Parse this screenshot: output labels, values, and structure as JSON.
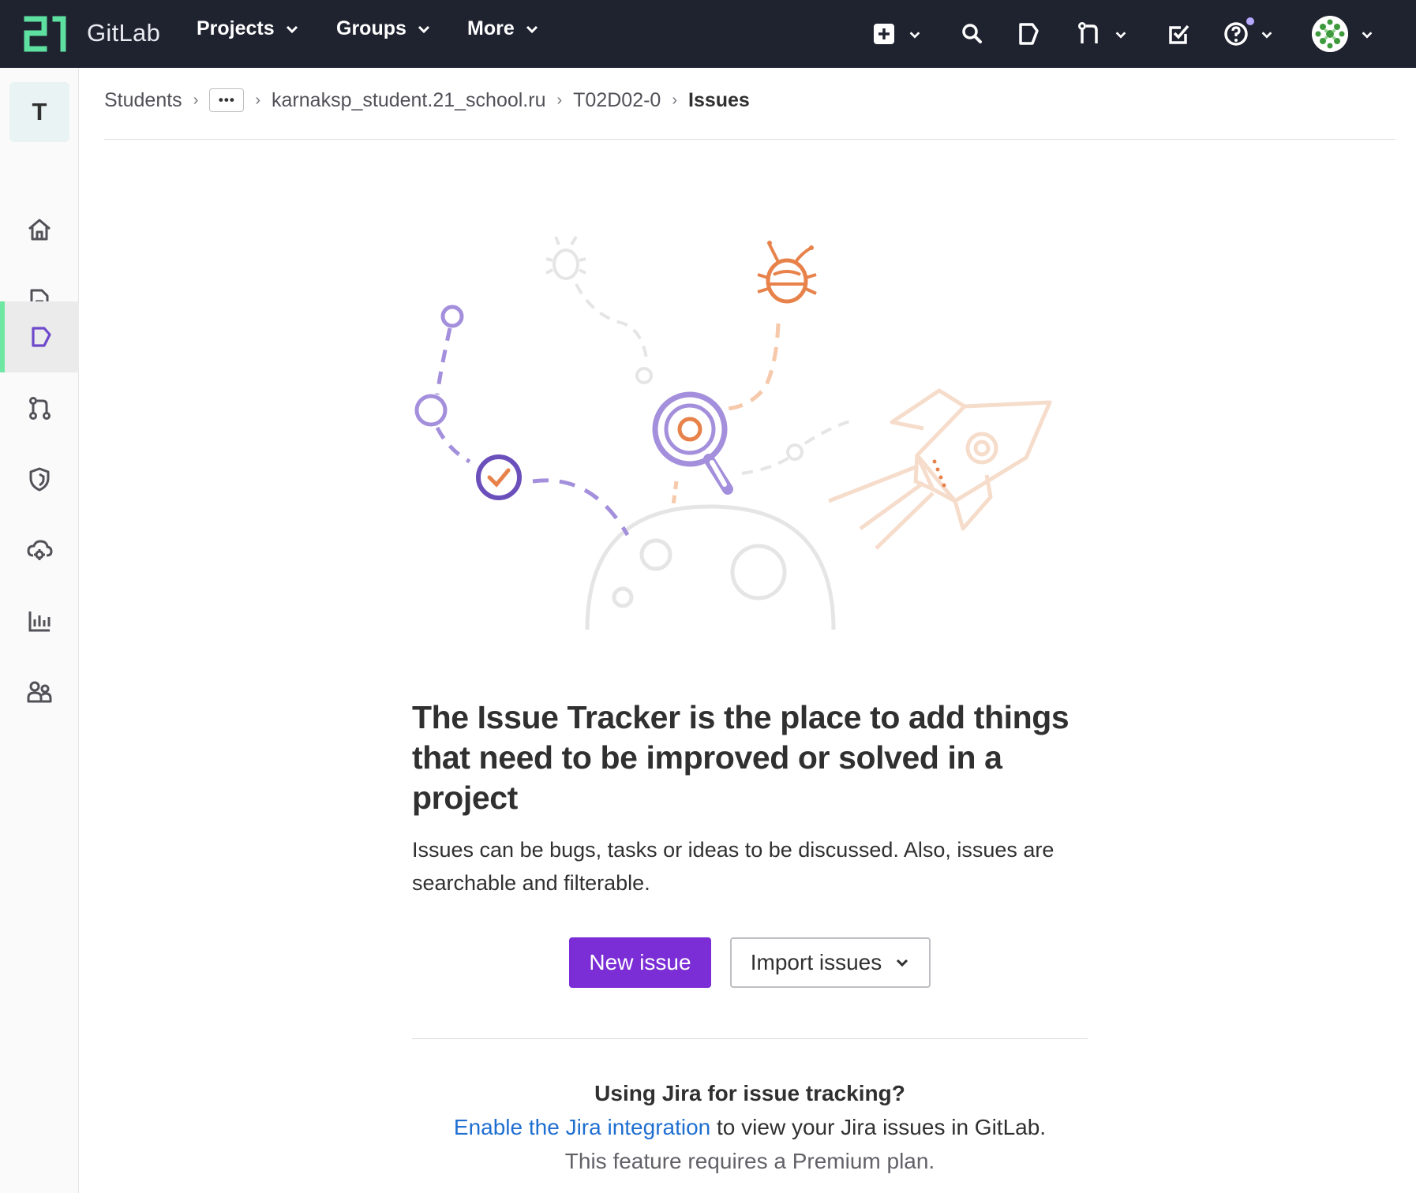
{
  "brand": {
    "name": "GitLab"
  },
  "topnav": {
    "menus": [
      {
        "label": "Projects"
      },
      {
        "label": "Groups"
      },
      {
        "label": "More"
      }
    ]
  },
  "sidebar": {
    "project_initial": "T",
    "items": [
      {
        "icon": "home-icon"
      },
      {
        "icon": "document-icon"
      },
      {
        "icon": "issues-icon",
        "active": true
      },
      {
        "icon": "merge-request-icon"
      },
      {
        "icon": "shield-icon"
      },
      {
        "icon": "cloud-gear-icon"
      },
      {
        "icon": "chart-icon"
      },
      {
        "icon": "users-icon"
      }
    ]
  },
  "breadcrumb": {
    "items": [
      "Students",
      "karnaksp_student.21_school.ru",
      "T02D02-0"
    ],
    "ellipsis": "•••",
    "current": "Issues"
  },
  "empty_state": {
    "title": "The Issue Tracker is the place to add things that need to be improved or solved in a project",
    "description": "Issues can be bugs, tasks or ideas to be discussed. Also, issues are searchable and filterable.",
    "primary_button": "New issue",
    "secondary_button": "Import issues"
  },
  "jira": {
    "title": "Using Jira for issue tracking?",
    "link_text": "Enable the Jira integration",
    "after_link": " to view your Jira issues in GitLab.",
    "note": "This feature requires a Premium plan."
  },
  "colors": {
    "primary": "#7b2ed6",
    "nav_bg": "#1f2330",
    "accent_green": "#6ee7a3",
    "link": "#1f6fd1"
  }
}
